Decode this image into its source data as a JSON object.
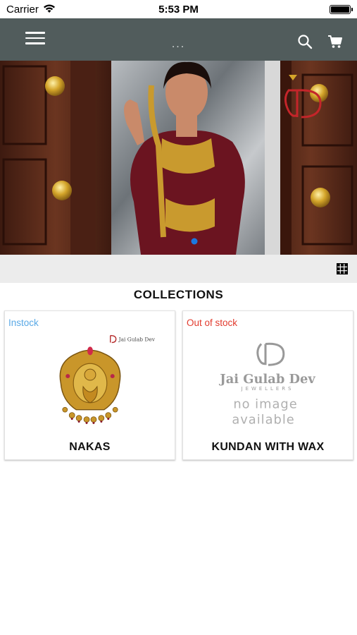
{
  "status_bar": {
    "carrier": "Carrier",
    "time": "5:53 PM"
  },
  "nav": {
    "title": "...",
    "icons": [
      "menu-icon",
      "search-icon",
      "cart-icon"
    ],
    "background": "#515c5c"
  },
  "banner": {
    "logo_text": "JD",
    "slide_count": 1,
    "active_slide": 1
  },
  "toolbar": {
    "icon": "grid-view-icon"
  },
  "collections": {
    "title": "COLLECTIONS",
    "items": [
      {
        "name": "NAKAS",
        "stock": "Instock",
        "stock_color": "#5aa9e6",
        "image_watermark": "Jai Gulab Dev"
      },
      {
        "name": "KUNDAN WITH WAX",
        "stock": "Out of stock",
        "stock_color": "#e23b2e",
        "placeholder_brand": "Jai Gulab Dev",
        "placeholder_sub": "JEWELLERS",
        "placeholder_line1": "no image",
        "placeholder_line2": "available"
      }
    ]
  }
}
